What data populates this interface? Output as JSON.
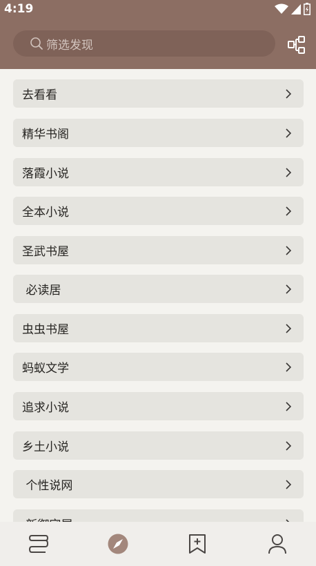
{
  "status_bar": {
    "time": "4:19"
  },
  "search": {
    "placeholder": "筛选发现"
  },
  "list_items": [
    {
      "label": "去看看"
    },
    {
      "label": "精华书阁"
    },
    {
      "label": "落霞小说"
    },
    {
      "label": "全本小说"
    },
    {
      "label": "圣武书屋"
    },
    {
      "label": " 必读居"
    },
    {
      "label": "虫虫书屋"
    },
    {
      "label": "蚂蚁文学"
    },
    {
      "label": "追求小说"
    },
    {
      "label": "乡土小说"
    },
    {
      "label": " 个性说网"
    },
    {
      "label": " 新御宅屋"
    }
  ],
  "bottom_nav": {
    "items": [
      {
        "icon": "bookshelf-icon"
      },
      {
        "icon": "compass-icon",
        "active": true
      },
      {
        "icon": "bookmark-add-icon"
      },
      {
        "icon": "person-icon"
      }
    ]
  },
  "colors": {
    "header_bg": "#8c6e63",
    "search_bg": "#7f6258",
    "page_bg": "#f4f3ef",
    "row_bg": "#e5e4df",
    "nav_bg": "#f0eeeb",
    "nav_active": "#a3877c",
    "nav_inactive": "#4a4644"
  }
}
